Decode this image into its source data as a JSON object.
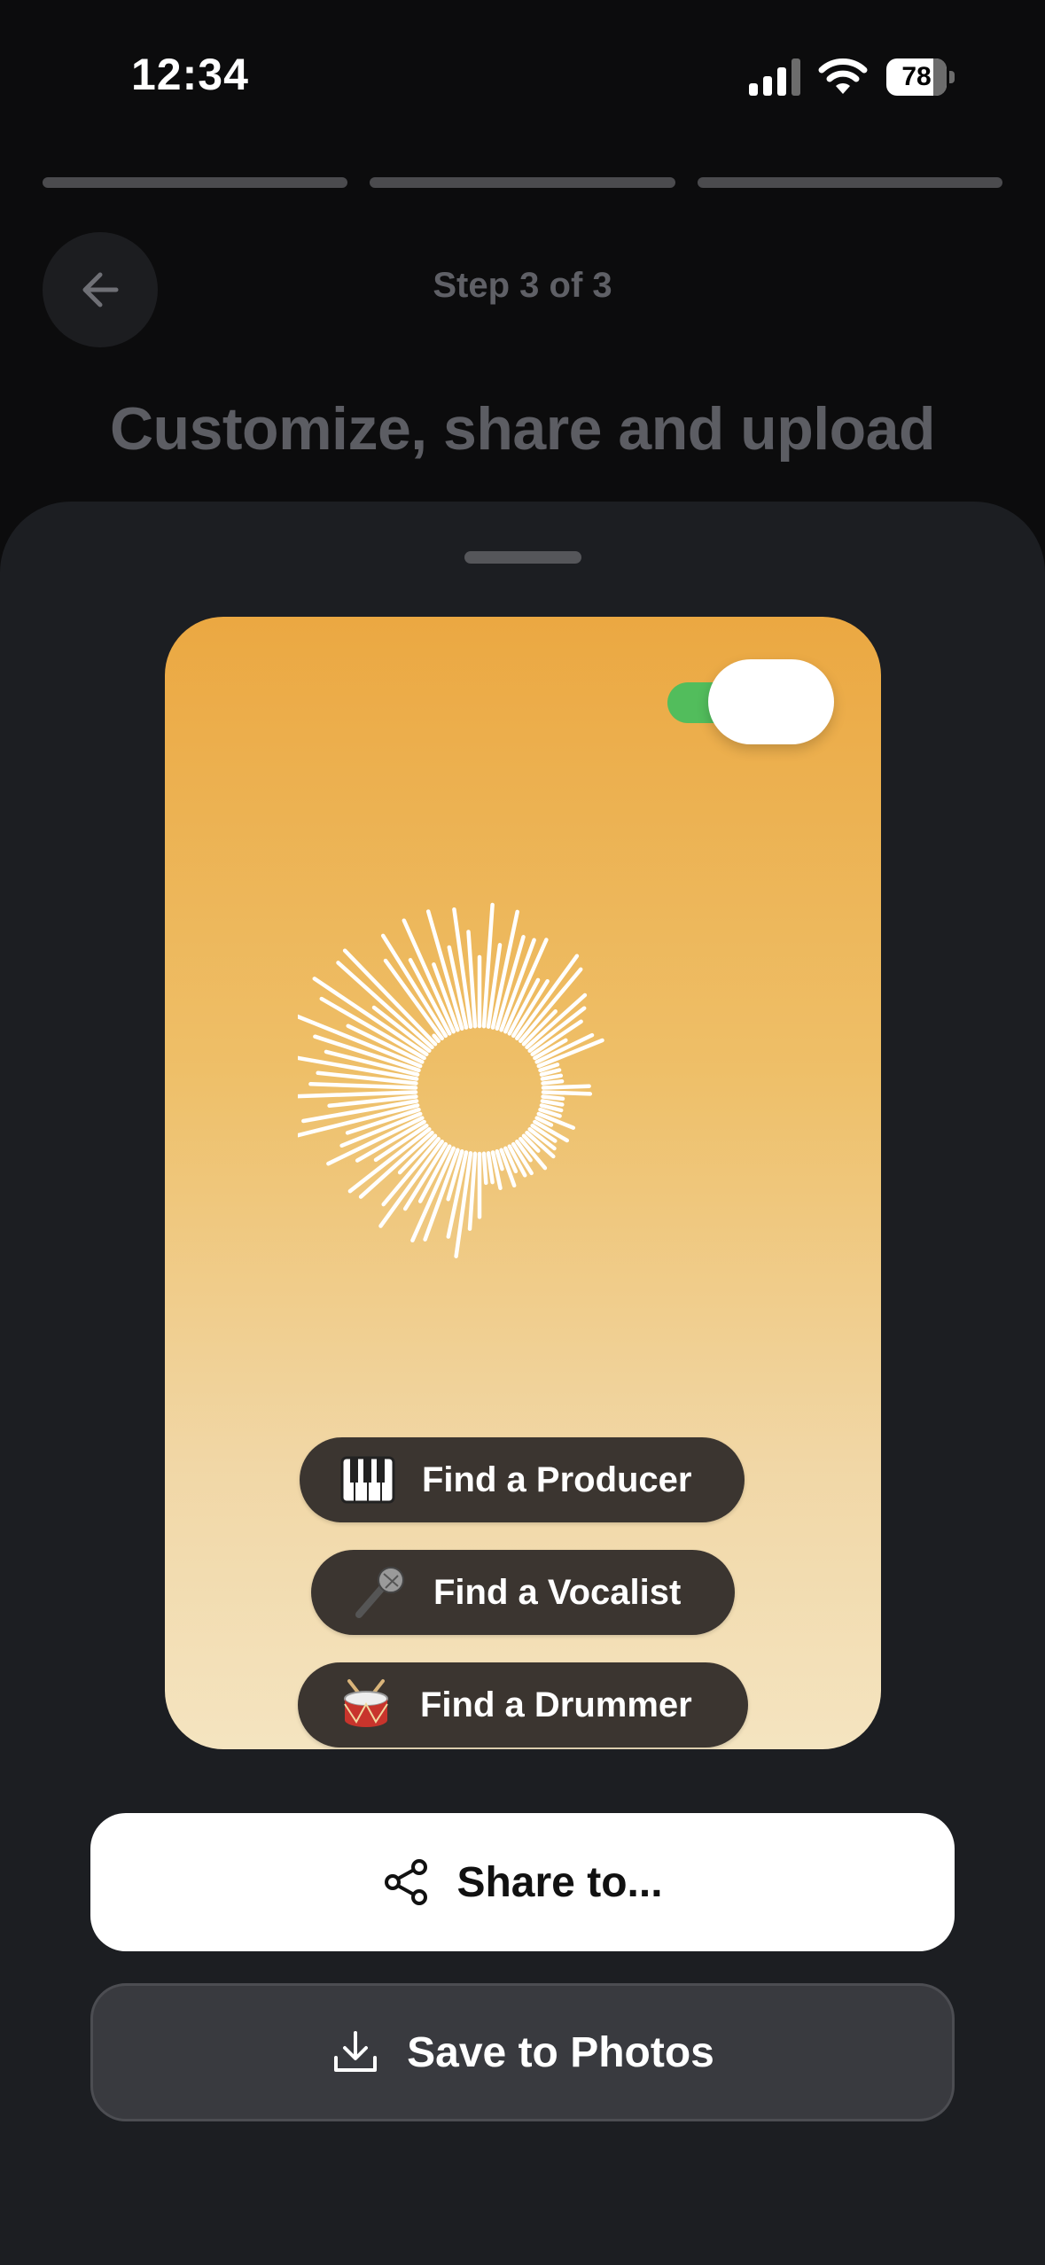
{
  "status_bar": {
    "time": "12:34",
    "battery_percent": "78",
    "battery_level": 0.78
  },
  "progress": {
    "total_steps": 3,
    "completed_steps": 3
  },
  "header": {
    "step_label": "Step 3 of 3",
    "title": "Customize, share and upload"
  },
  "card": {
    "toggle_on": true,
    "gradient_colors": [
      "#eba842",
      "#f4e4c0"
    ],
    "tags": [
      {
        "icon": "piano-keys-icon",
        "label": "Find a Producer"
      },
      {
        "icon": "microphone-icon",
        "label": "Find a Vocalist"
      },
      {
        "icon": "drum-icon",
        "label": "Find a Drummer"
      }
    ]
  },
  "actions": {
    "share_label": "Share to...",
    "save_label": "Save to Photos"
  },
  "colors": {
    "accent_green": "#52bd5c",
    "sheet_bg": "#1c1e22"
  }
}
